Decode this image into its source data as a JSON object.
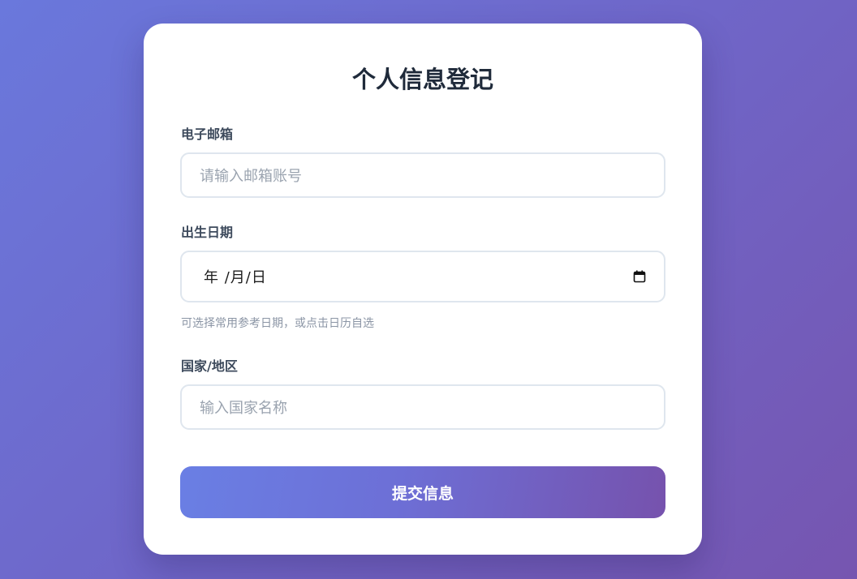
{
  "form": {
    "title": "个人信息登记",
    "email": {
      "label": "电子邮箱",
      "placeholder": "请输入邮箱账号"
    },
    "birthdate": {
      "label": "出生日期",
      "display": "年 /月/日",
      "hint": "可选择常用参考日期，或点击日历自选"
    },
    "country": {
      "label": "国家/地区",
      "placeholder": "输入国家名称"
    },
    "submit_label": "提交信息"
  },
  "icons": {
    "calendar": "calendar-icon"
  }
}
